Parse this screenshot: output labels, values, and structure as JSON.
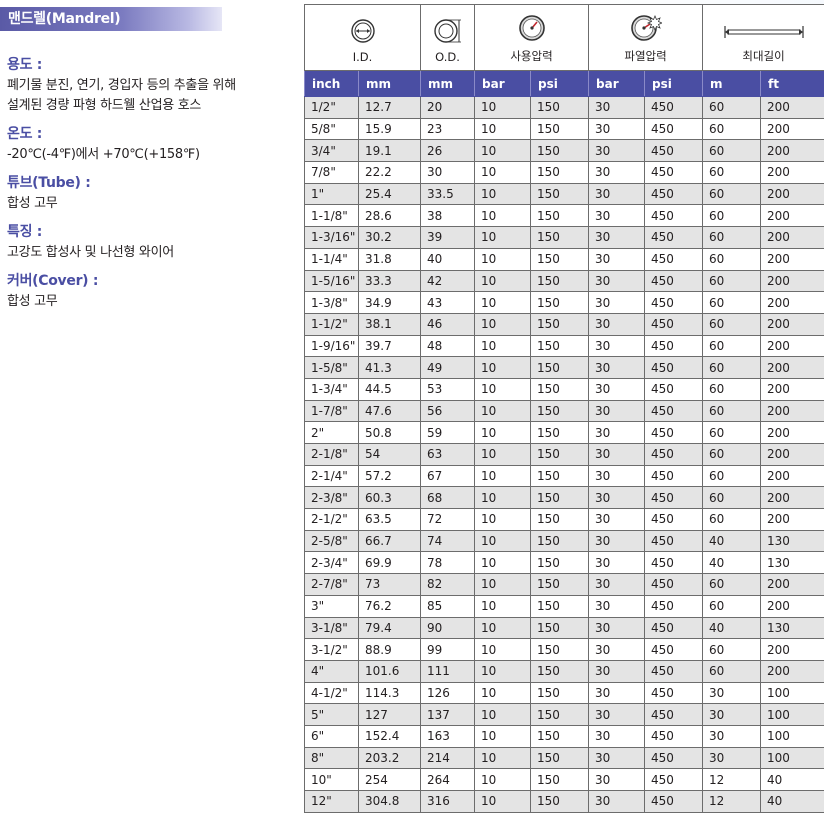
{
  "title": "맨드렐(Mandrel)",
  "specs": [
    {
      "label": "용도 :",
      "lines": [
        "폐기물 분진, 연기, 경입자 등의 추출을 위해",
        "설계된 경량 파형 하드웰 산업용 호스"
      ]
    },
    {
      "label": "온도 :",
      "lines": [
        "-20℃(-4℉)에서 +70℃(+158℉)"
      ]
    },
    {
      "label": "튜브(Tube) :",
      "lines": [
        "합성 고무"
      ]
    },
    {
      "label": "특징 :",
      "lines": [
        "고강도 합성사 및 나선형 와이어"
      ]
    },
    {
      "label": "커버(Cover) :",
      "lines": [
        "합성 고무"
      ]
    }
  ],
  "table": {
    "groups": {
      "id": "I.D.",
      "od": "O.D.",
      "working": "사용압력",
      "burst": "파열압력",
      "length": "최대길이"
    },
    "icons": {
      "id": "inner-diameter-icon",
      "od": "outer-diameter-icon",
      "working": "pressure-gauge-icon",
      "burst": "burst-gauge-icon",
      "length": "length-ruler-icon"
    },
    "colors": {
      "header": "#4a4ea3",
      "stripe": "#e4e4e4",
      "title_text": "#4a4ea3"
    },
    "units": [
      "inch",
      "mm",
      "mm",
      "bar",
      "psi",
      "bar",
      "psi",
      "m",
      "ft"
    ],
    "rows": [
      [
        "1/2\"",
        "12.7",
        "20",
        "10",
        "150",
        "30",
        "450",
        "60",
        "200"
      ],
      [
        "5/8\"",
        "15.9",
        "23",
        "10",
        "150",
        "30",
        "450",
        "60",
        "200"
      ],
      [
        "3/4\"",
        "19.1",
        "26",
        "10",
        "150",
        "30",
        "450",
        "60",
        "200"
      ],
      [
        "7/8\"",
        "22.2",
        "30",
        "10",
        "150",
        "30",
        "450",
        "60",
        "200"
      ],
      [
        "1\"",
        "25.4",
        "33.5",
        "10",
        "150",
        "30",
        "450",
        "60",
        "200"
      ],
      [
        "1-1/8\"",
        "28.6",
        "38",
        "10",
        "150",
        "30",
        "450",
        "60",
        "200"
      ],
      [
        "1-3/16\"",
        "30.2",
        "39",
        "10",
        "150",
        "30",
        "450",
        "60",
        "200"
      ],
      [
        "1-1/4\"",
        "31.8",
        "40",
        "10",
        "150",
        "30",
        "450",
        "60",
        "200"
      ],
      [
        "1-5/16\"",
        "33.3",
        "42",
        "10",
        "150",
        "30",
        "450",
        "60",
        "200"
      ],
      [
        "1-3/8\"",
        "34.9",
        "43",
        "10",
        "150",
        "30",
        "450",
        "60",
        "200"
      ],
      [
        "1-1/2\"",
        "38.1",
        "46",
        "10",
        "150",
        "30",
        "450",
        "60",
        "200"
      ],
      [
        "1-9/16\"",
        "39.7",
        "48",
        "10",
        "150",
        "30",
        "450",
        "60",
        "200"
      ],
      [
        "1-5/8\"",
        "41.3",
        "49",
        "10",
        "150",
        "30",
        "450",
        "60",
        "200"
      ],
      [
        "1-3/4\"",
        "44.5",
        "53",
        "10",
        "150",
        "30",
        "450",
        "60",
        "200"
      ],
      [
        "1-7/8\"",
        "47.6",
        "56",
        "10",
        "150",
        "30",
        "450",
        "60",
        "200"
      ],
      [
        "2\"",
        "50.8",
        "59",
        "10",
        "150",
        "30",
        "450",
        "60",
        "200"
      ],
      [
        "2-1/8\"",
        "54",
        "63",
        "10",
        "150",
        "30",
        "450",
        "60",
        "200"
      ],
      [
        "2-1/4\"",
        "57.2",
        "67",
        "10",
        "150",
        "30",
        "450",
        "60",
        "200"
      ],
      [
        "2-3/8\"",
        "60.3",
        "68",
        "10",
        "150",
        "30",
        "450",
        "60",
        "200"
      ],
      [
        "2-1/2\"",
        "63.5",
        "72",
        "10",
        "150",
        "30",
        "450",
        "60",
        "200"
      ],
      [
        "2-5/8\"",
        "66.7",
        "74",
        "10",
        "150",
        "30",
        "450",
        "40",
        "130"
      ],
      [
        "2-3/4\"",
        "69.9",
        "78",
        "10",
        "150",
        "30",
        "450",
        "40",
        "130"
      ],
      [
        "2-7/8\"",
        "73",
        "82",
        "10",
        "150",
        "30",
        "450",
        "60",
        "200"
      ],
      [
        "3\"",
        "76.2",
        "85",
        "10",
        "150",
        "30",
        "450",
        "60",
        "200"
      ],
      [
        "3-1/8\"",
        "79.4",
        "90",
        "10",
        "150",
        "30",
        "450",
        "40",
        "130"
      ],
      [
        "3-1/2\"",
        "88.9",
        "99",
        "10",
        "150",
        "30",
        "450",
        "60",
        "200"
      ],
      [
        "4\"",
        "101.6",
        "111",
        "10",
        "150",
        "30",
        "450",
        "60",
        "200"
      ],
      [
        "4-1/2\"",
        "114.3",
        "126",
        "10",
        "150",
        "30",
        "450",
        "30",
        "100"
      ],
      [
        "5\"",
        "127",
        "137",
        "10",
        "150",
        "30",
        "450",
        "30",
        "100"
      ],
      [
        "6\"",
        "152.4",
        "163",
        "10",
        "150",
        "30",
        "450",
        "30",
        "100"
      ],
      [
        "8\"",
        "203.2",
        "214",
        "10",
        "150",
        "30",
        "450",
        "30",
        "100"
      ],
      [
        "10\"",
        "254",
        "264",
        "10",
        "150",
        "30",
        "450",
        "12",
        "40"
      ],
      [
        "12\"",
        "304.8",
        "316",
        "10",
        "150",
        "30",
        "450",
        "12",
        "40"
      ]
    ]
  }
}
